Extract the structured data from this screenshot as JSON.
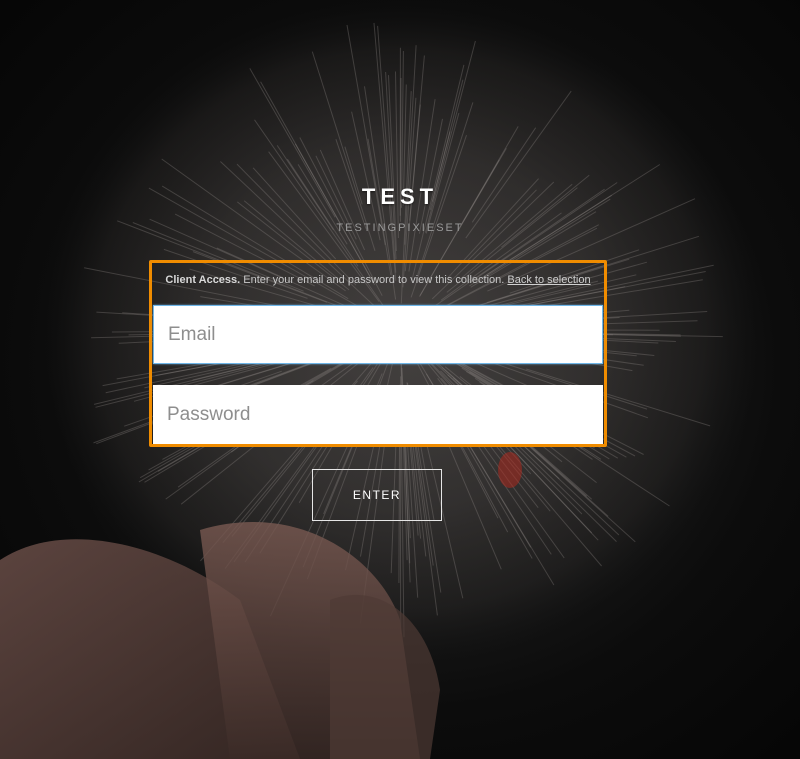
{
  "gallery": {
    "title": "TEST",
    "subtitle": "TESTINGPIXIESET"
  },
  "login": {
    "note_strong": "Client Access.",
    "note_text": " Enter your email and password to view this collection. ",
    "back_link": "Back to selection",
    "email_placeholder": "Email",
    "password_placeholder": "Password",
    "submit_label": "ENTER"
  },
  "colors": {
    "focus_outline": "#f08c00",
    "input_focus_border": "#6fb6e8",
    "background": "#0c0c0c"
  }
}
